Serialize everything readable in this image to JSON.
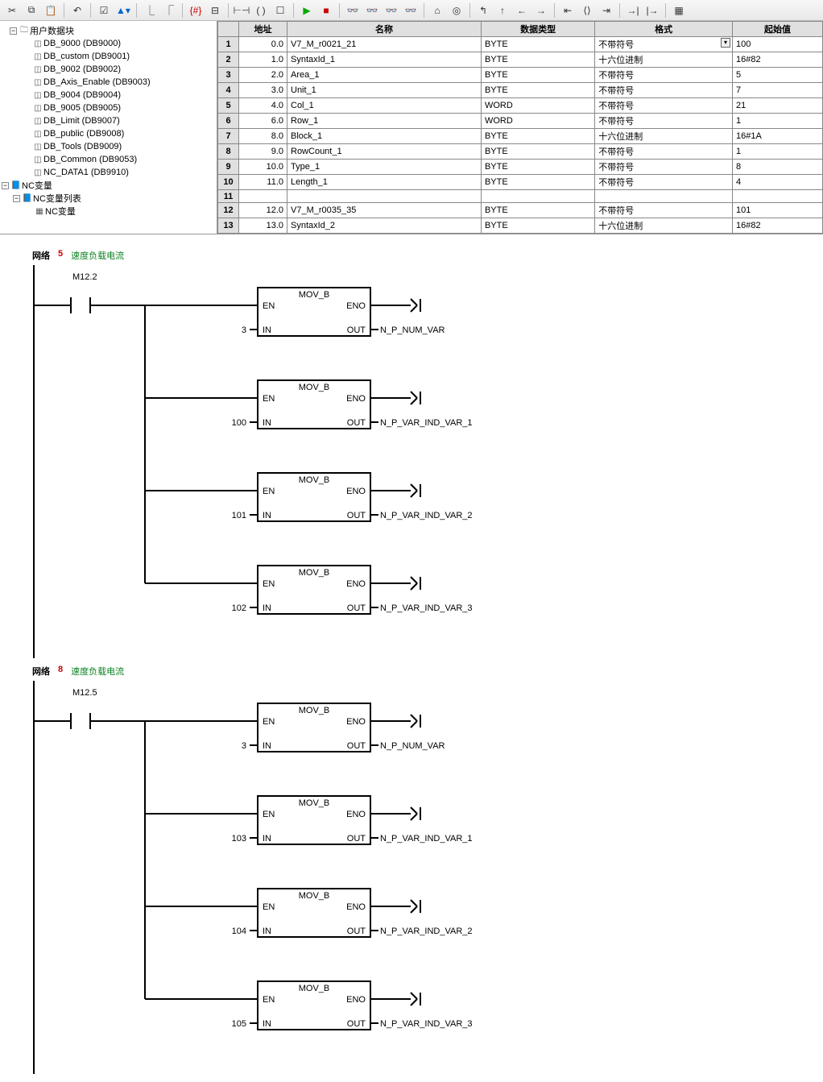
{
  "toolbar": {
    "icons": [
      "cut",
      "copy",
      "paste",
      "undo",
      "check",
      "arrow-down",
      "branch-up",
      "branch-down",
      "symbol",
      "if",
      "contact",
      "coil",
      "box",
      "run",
      "stop",
      "monitor1",
      "monitor2",
      "monitor3",
      "monitor4",
      "home",
      "target",
      "nav-left",
      "nav-up",
      "nav-right",
      "jump-in",
      "jump-out",
      "step",
      "goto",
      "grid"
    ]
  },
  "tree": {
    "title": "用户数据块",
    "items": [
      "DB_9000 (DB9000)",
      "DB_custom (DB9001)",
      "DB_9002 (DB9002)",
      "DB_Axis_Enable (DB9003)",
      "DB_9004 (DB9004)",
      "DB_9005 (DB9005)",
      "DB_Limit (DB9007)",
      "DB_public (DB9008)",
      "DB_Tools (DB9009)",
      "DB_Common (DB9053)",
      "NC_DATA1 (DB9910)"
    ],
    "nc_var": "NC变量",
    "nc_var_list": "NC变量列表",
    "nc_var_item": "NC变量"
  },
  "table": {
    "headers": {
      "addr": "地址",
      "name": "名称",
      "type": "数据类型",
      "format": "格式",
      "init": "起始值"
    },
    "rows": [
      {
        "n": "1",
        "addr": "0.0",
        "name": "V7_M_r0021_21",
        "type": "BYTE",
        "fmt": "不带符号",
        "init": "100",
        "dd": true
      },
      {
        "n": "2",
        "addr": "1.0",
        "name": "SyntaxId_1",
        "type": "BYTE",
        "fmt": "十六位进制",
        "init": "16#82"
      },
      {
        "n": "3",
        "addr": "2.0",
        "name": "Area_1",
        "type": "BYTE",
        "fmt": "不带符号",
        "init": "5"
      },
      {
        "n": "4",
        "addr": "3.0",
        "name": "Unit_1",
        "type": "BYTE",
        "fmt": "不带符号",
        "init": "7"
      },
      {
        "n": "5",
        "addr": "4.0",
        "name": "Col_1",
        "type": "WORD",
        "fmt": "不带符号",
        "init": "21"
      },
      {
        "n": "6",
        "addr": "6.0",
        "name": "Row_1",
        "type": "WORD",
        "fmt": "不带符号",
        "init": "1"
      },
      {
        "n": "7",
        "addr": "8.0",
        "name": "Block_1",
        "type": "BYTE",
        "fmt": "十六位进制",
        "init": "16#1A"
      },
      {
        "n": "8",
        "addr": "9.0",
        "name": "RowCount_1",
        "type": "BYTE",
        "fmt": "不带符号",
        "init": "1"
      },
      {
        "n": "9",
        "addr": "10.0",
        "name": "Type_1",
        "type": "BYTE",
        "fmt": "不带符号",
        "init": "8"
      },
      {
        "n": "10",
        "addr": "11.0",
        "name": "Length_1",
        "type": "BYTE",
        "fmt": "不带符号",
        "init": "4"
      },
      {
        "n": "11",
        "addr": "",
        "name": "",
        "type": "",
        "fmt": "",
        "init": ""
      },
      {
        "n": "12",
        "addr": "12.0",
        "name": "V7_M_r0035_35",
        "type": "BYTE",
        "fmt": "不带符号",
        "init": "101"
      },
      {
        "n": "13",
        "addr": "13.0",
        "name": "SyntaxId_2",
        "type": "BYTE",
        "fmt": "十六位进制",
        "init": "16#82"
      }
    ]
  },
  "networks": [
    {
      "label": "网络",
      "num": "5",
      "title": "速度负载电流",
      "contact": "M12.2",
      "blocks": [
        {
          "name": "MOV_B",
          "en": "EN",
          "eno": "ENO",
          "in_lbl": "IN",
          "out_lbl": "OUT",
          "in": "3",
          "out": "N_P_NUM_VAR"
        },
        {
          "name": "MOV_B",
          "en": "EN",
          "eno": "ENO",
          "in_lbl": "IN",
          "out_lbl": "OUT",
          "in": "100",
          "out": "N_P_VAR_IND_VAR_1"
        },
        {
          "name": "MOV_B",
          "en": "EN",
          "eno": "ENO",
          "in_lbl": "IN",
          "out_lbl": "OUT",
          "in": "101",
          "out": "N_P_VAR_IND_VAR_2"
        },
        {
          "name": "MOV_B",
          "en": "EN",
          "eno": "ENO",
          "in_lbl": "IN",
          "out_lbl": "OUT",
          "in": "102",
          "out": "N_P_VAR_IND_VAR_3"
        }
      ]
    },
    {
      "label": "网络",
      "num": "8",
      "title": "速度负载电流",
      "contact": "M12.5",
      "blocks": [
        {
          "name": "MOV_B",
          "en": "EN",
          "eno": "ENO",
          "in_lbl": "IN",
          "out_lbl": "OUT",
          "in": "3",
          "out": "N_P_NUM_VAR"
        },
        {
          "name": "MOV_B",
          "en": "EN",
          "eno": "ENO",
          "in_lbl": "IN",
          "out_lbl": "OUT",
          "in": "103",
          "out": "N_P_VAR_IND_VAR_1"
        },
        {
          "name": "MOV_B",
          "en": "EN",
          "eno": "ENO",
          "in_lbl": "IN",
          "out_lbl": "OUT",
          "in": "104",
          "out": "N_P_VAR_IND_VAR_2"
        },
        {
          "name": "MOV_B",
          "en": "EN",
          "eno": "ENO",
          "in_lbl": "IN",
          "out_lbl": "OUT",
          "in": "105",
          "out": "N_P_VAR_IND_VAR_3"
        }
      ]
    }
  ]
}
